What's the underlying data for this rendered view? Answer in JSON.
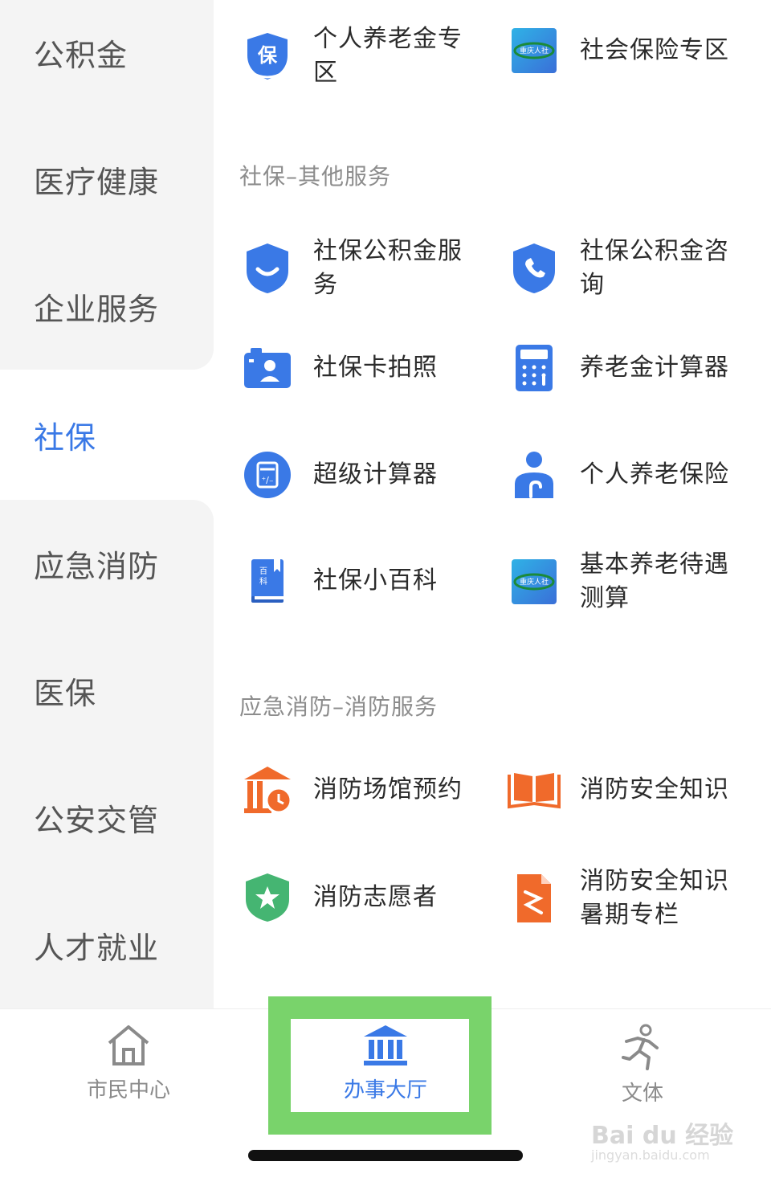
{
  "sidebar": {
    "items": [
      {
        "label": "公积金"
      },
      {
        "label": "医疗健康"
      },
      {
        "label": "企业服务"
      },
      {
        "label": "社保"
      },
      {
        "label": "应急消防"
      },
      {
        "label": "医保"
      },
      {
        "label": "公安交管"
      },
      {
        "label": "人才就业"
      }
    ],
    "active": "社保"
  },
  "main": {
    "top_items": [
      {
        "label": "个人养老金专区",
        "icon": "bao-shield-icon"
      },
      {
        "label": "社会保险专区",
        "icon": "chongqing-hrss-logo-icon"
      }
    ],
    "section1": {
      "title": "社保–其他服务",
      "items": [
        {
          "label": "社保公积金服务",
          "icon": "smile-shield-icon"
        },
        {
          "label": "社保公积金咨询",
          "icon": "phone-shield-icon"
        },
        {
          "label": "社保卡拍照",
          "icon": "camera-id-icon"
        },
        {
          "label": "养老金计算器",
          "icon": "calculator-icon"
        },
        {
          "label": "超级计算器",
          "icon": "calculator-circle-icon"
        },
        {
          "label": "个人养老保险",
          "icon": "person-umbrella-icon"
        },
        {
          "label": "社保小百科",
          "icon": "encyclopedia-book-icon"
        },
        {
          "label": "基本养老待遇测算",
          "icon": "chongqing-hrss-logo-icon"
        }
      ]
    },
    "section2": {
      "title": "应急消防–消防服务",
      "items": [
        {
          "label": "消防场馆预约",
          "icon": "venue-clock-icon"
        },
        {
          "label": "消防安全知识",
          "icon": "open-book-icon"
        },
        {
          "label": "消防志愿者",
          "icon": "star-shield-icon"
        },
        {
          "label": "消防安全知识暑期专栏",
          "icon": "document-icon"
        }
      ]
    },
    "logo_text": "重庆人社"
  },
  "tabbar": {
    "tabs": [
      {
        "label": "市民中心",
        "icon": "home-icon"
      },
      {
        "label": "办事大厅",
        "icon": "hall-building-icon"
      },
      {
        "label": "文体",
        "icon": "running-person-icon"
      }
    ],
    "active": "办事大厅"
  },
  "watermark": {
    "brand": "Bai du 经验",
    "url": "jingyan.baidu.com"
  },
  "colors": {
    "accent": "#3a79e6",
    "fire": "#f06a2b",
    "green": "#45b572",
    "highlight": "#79d36b",
    "sidebar_bg": "#f4f4f4"
  }
}
